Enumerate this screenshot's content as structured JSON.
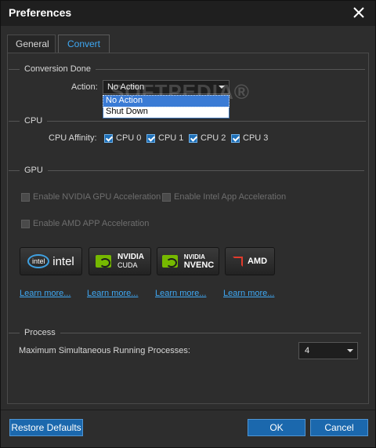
{
  "window": {
    "title": "Preferences"
  },
  "tabs": [
    {
      "label": "General",
      "active": false
    },
    {
      "label": "Convert",
      "active": true
    }
  ],
  "conversion_done": {
    "heading": "Conversion Done",
    "action_label": "Action:",
    "selected": "No Action",
    "options": [
      "No Action",
      "Shut Down"
    ]
  },
  "cpu": {
    "heading": "CPU",
    "affinity_label": "CPU Affinity:",
    "cores": [
      {
        "label": "CPU 0",
        "checked": true
      },
      {
        "label": "CPU 1",
        "checked": true
      },
      {
        "label": "CPU 2",
        "checked": true
      },
      {
        "label": "CPU 3",
        "checked": true
      }
    ]
  },
  "gpu": {
    "heading": "GPU",
    "options": [
      {
        "label": "Enable NVIDIA GPU Acceleration",
        "checked": false,
        "enabled": false
      },
      {
        "label": "Enable Intel App Acceleration",
        "checked": false,
        "enabled": false
      },
      {
        "label": "Enable AMD APP Acceleration",
        "checked": false,
        "enabled": false
      }
    ],
    "vendors": [
      {
        "name": "intel",
        "logo_text": "intel",
        "oval_text": "intel"
      },
      {
        "name": "nvidia-cuda",
        "top": "NVIDIA",
        "bottom": "CUDA"
      },
      {
        "name": "nvidia-nvenc",
        "top": "NVIDIA",
        "bottom": "NVENC"
      },
      {
        "name": "amd",
        "logo_text": "AMD"
      }
    ],
    "learn_more": "Learn more...",
    "accent_color": "#3fa9f5"
  },
  "process": {
    "heading": "Process",
    "max_label": "Maximum Simultaneous Running Processes:",
    "value": "4"
  },
  "footer": {
    "restore_label": "Restore Defaults",
    "ok_label": "OK",
    "cancel_label": "Cancel"
  },
  "watermark": "SOFTPEDIA®"
}
